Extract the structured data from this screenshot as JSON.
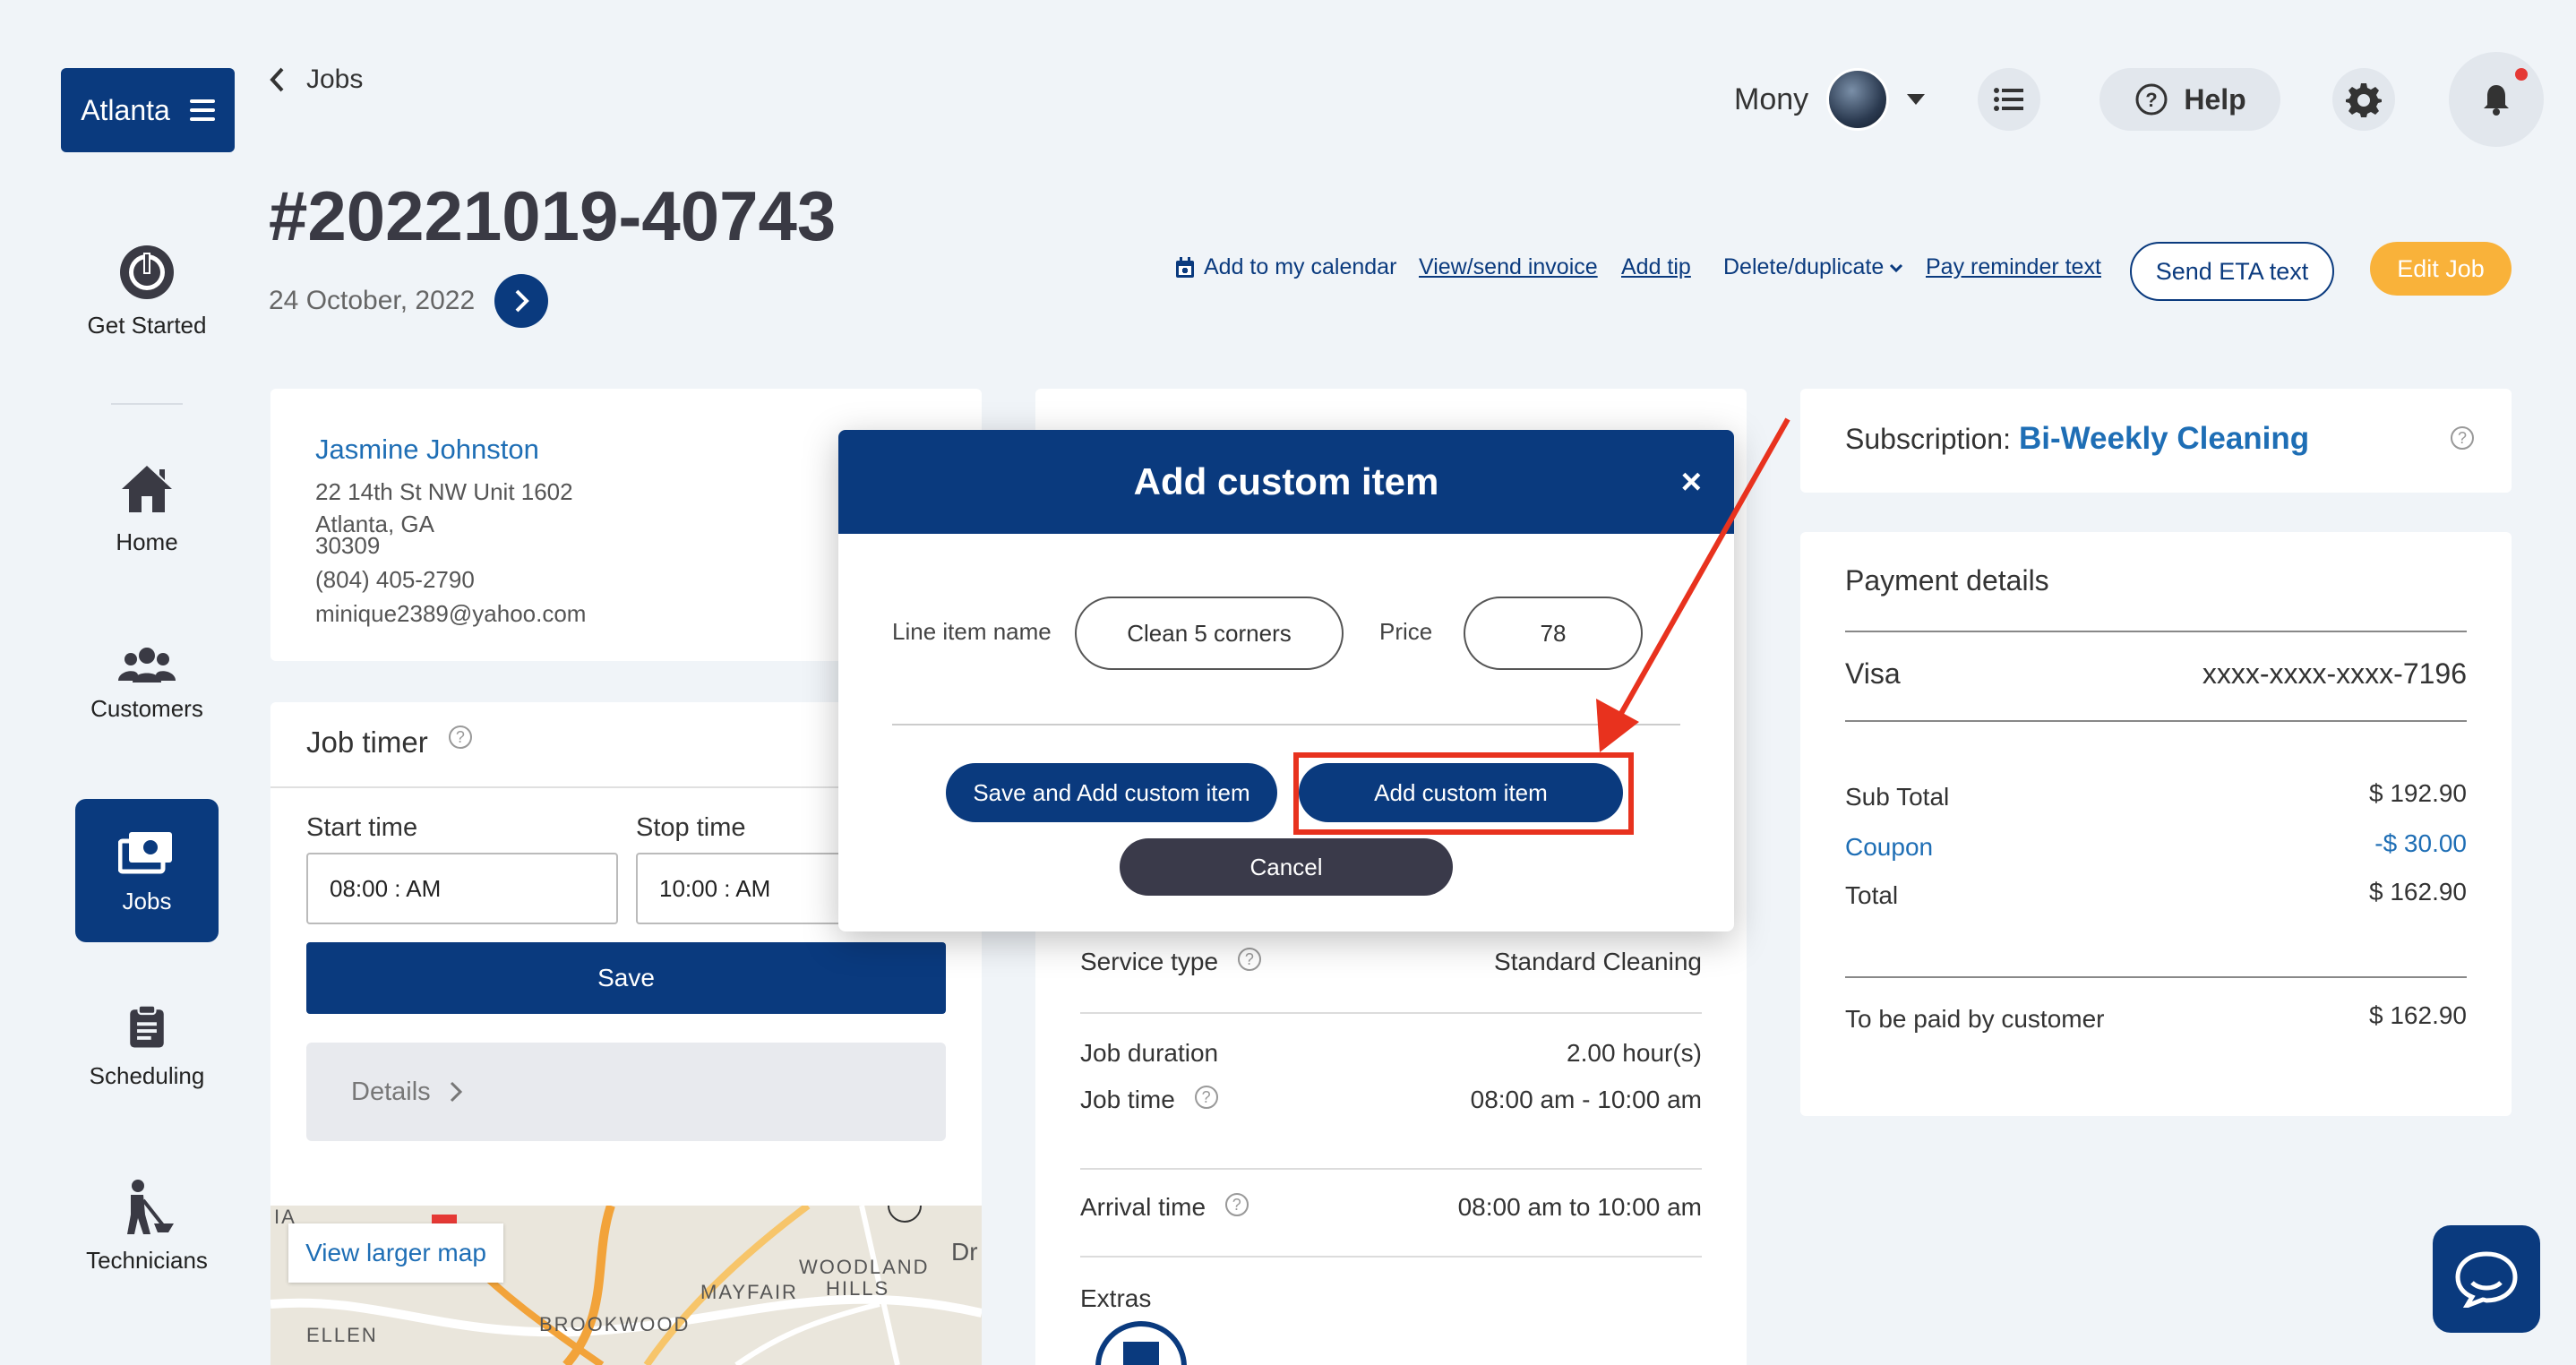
{
  "sidebar": {
    "brand": "Atlanta",
    "items": [
      {
        "label": "Get Started"
      },
      {
        "label": "Home"
      },
      {
        "label": "Customers"
      },
      {
        "label": "Jobs"
      },
      {
        "label": "Scheduling"
      },
      {
        "label": "Technicians"
      }
    ]
  },
  "header": {
    "breadcrumb": "Jobs",
    "user_name": "Mony",
    "help_label": "Help"
  },
  "job": {
    "number": "#20221019-40743",
    "date": "24 October, 2022",
    "actions": {
      "calendar": "Add to my calendar",
      "invoice": "View/send invoice",
      "tip": "Add tip",
      "delete": "Delete/duplicate",
      "reminder": "Pay reminder text",
      "eta": "Send ETA text",
      "edit": "Edit Job"
    }
  },
  "customer": {
    "name": "Jasmine Johnston",
    "address1": "22 14th St NW Unit 1602",
    "address2": "Atlanta, GA",
    "zip": "30309",
    "phone": "(804) 405-2790",
    "email": "minique2389@yahoo.com"
  },
  "timer": {
    "title": "Job timer",
    "start_label": "Start time",
    "start_value": "08:00 : AM",
    "stop_label": "Stop time",
    "stop_value": "10:00 : AM",
    "save": "Save",
    "details": "Details",
    "map_link": "View larger map",
    "map_labels": [
      "WOODLAND",
      "HILLS",
      "MAYFAIR",
      "BROOKWOOD",
      "ELLEN",
      "Dr",
      "IA"
    ]
  },
  "service": {
    "service_type_label": "Service type",
    "service_type_value": "Standard Cleaning",
    "duration_label": "Job duration",
    "duration_value": "2.00 hour(s)",
    "time_label": "Job time",
    "time_value": "08:00 am - 10:00 am",
    "arrival_label": "Arrival time",
    "arrival_value": "08:00 am to 10:00 am",
    "extras_label": "Extras"
  },
  "subscription": {
    "label": "Subscription:",
    "value": "Bi-Weekly Cleaning"
  },
  "payment": {
    "title": "Payment details",
    "card_type": "Visa",
    "card_number": "xxxx-xxxx-xxxx-7196",
    "subtotal_label": "Sub Total",
    "subtotal_value": "$ 192.90",
    "coupon_label": "Coupon",
    "coupon_value": "-$ 30.00",
    "total_label": "Total",
    "total_value": "$ 162.90",
    "paid_label": "To be paid by customer",
    "paid_value": "$ 162.90"
  },
  "modal": {
    "title": "Add custom item",
    "close": "×",
    "name_label": "Line item name",
    "name_value": "Clean 5 corners",
    "price_label": "Price",
    "price_value": "78",
    "save_add": "Save and Add custom item",
    "add": "Add custom item",
    "cancel": "Cancel"
  },
  "colors": {
    "primary": "#0a3a7e",
    "accent": "#f9b23a",
    "link": "#1e6eb5",
    "annotation": "#e8321e"
  }
}
